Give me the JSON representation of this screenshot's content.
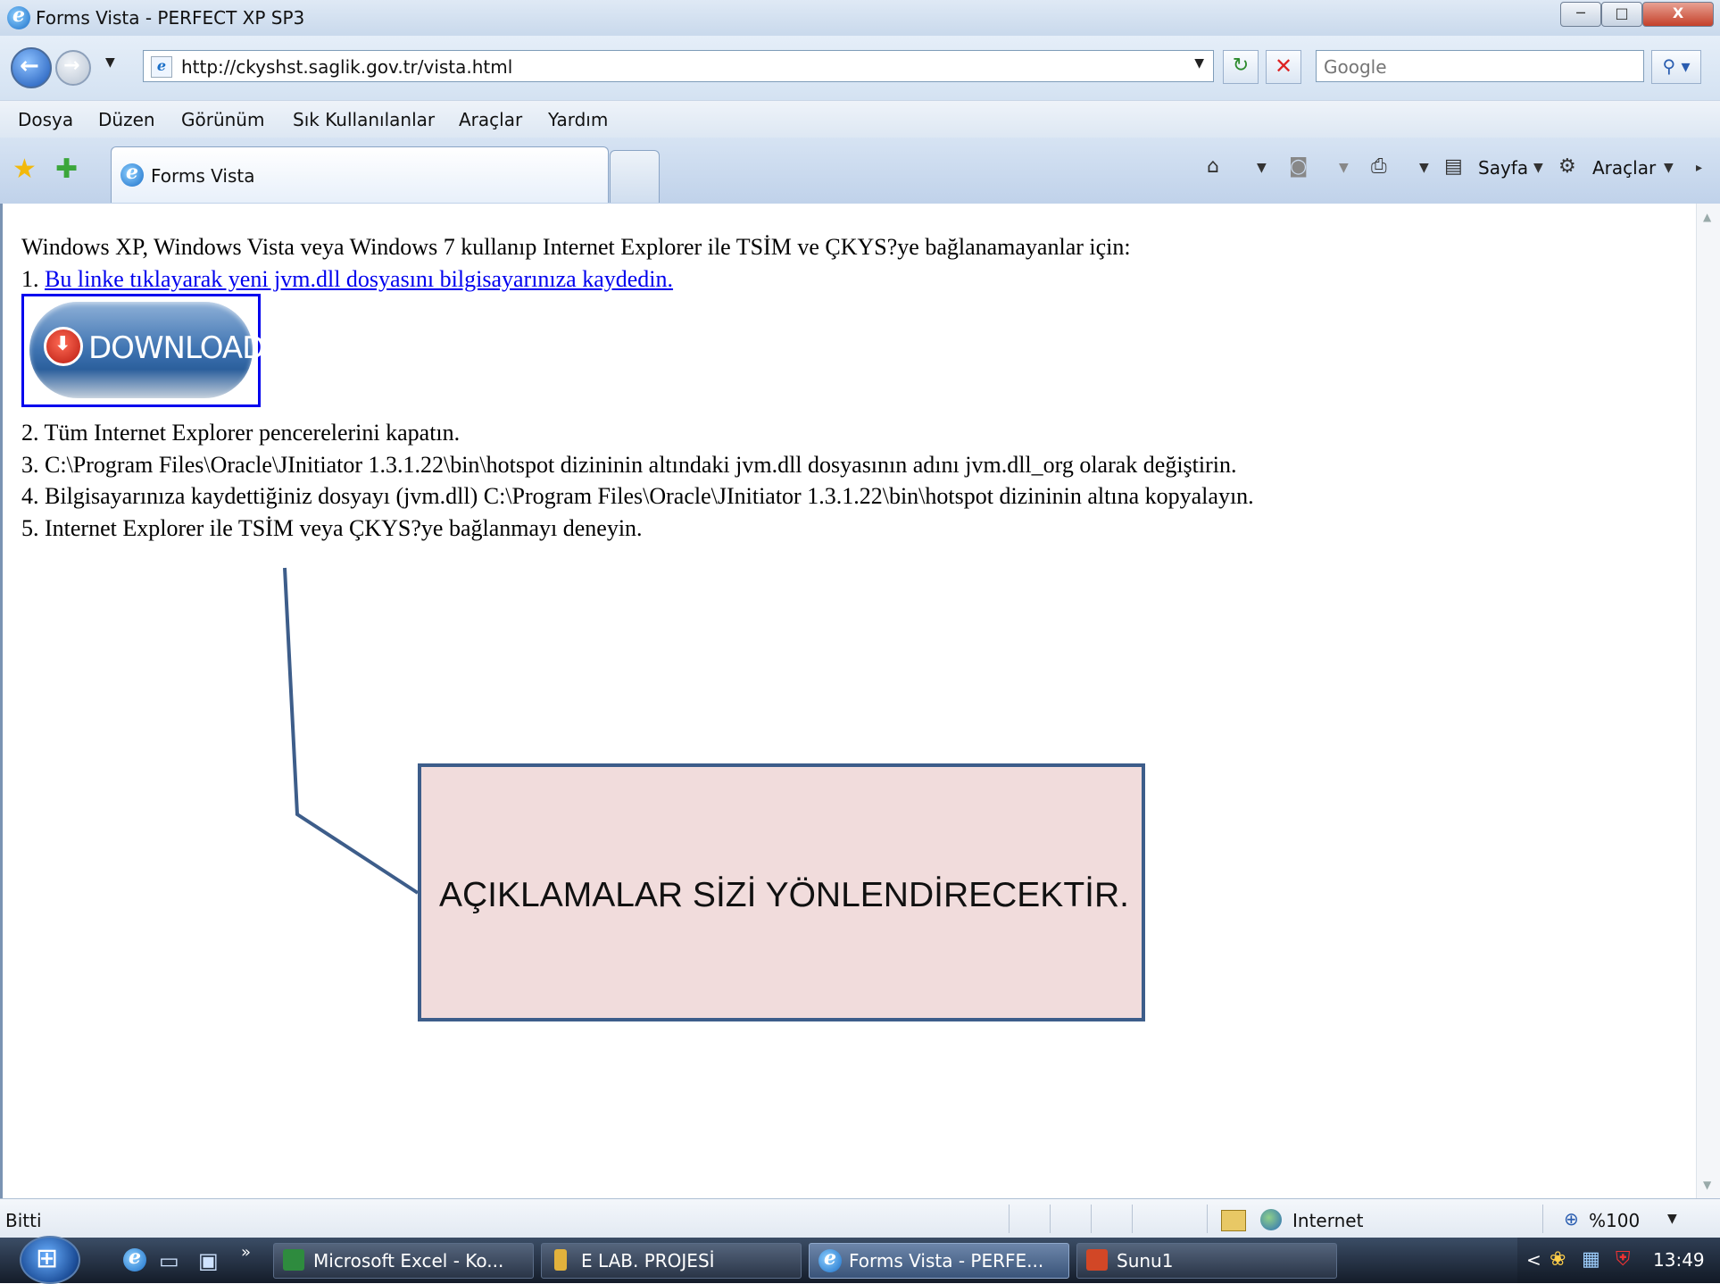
{
  "window": {
    "title": "Forms Vista - PERFECT XP SP3",
    "min_label": "─",
    "max_label": "□",
    "close_label": "X"
  },
  "address_bar": {
    "url": "http://ckyshst.saglik.gov.tr/vista.html",
    "search_placeholder": "Google"
  },
  "menu": [
    "Dosya",
    "Düzen",
    "Görünüm",
    "Sık Kullanılanlar",
    "Araçlar",
    "Yardım"
  ],
  "tabs": [
    {
      "label": "Forms Vista",
      "active": true
    }
  ],
  "command_bar": {
    "page_label": "Sayfa",
    "tools_label": "Araçlar"
  },
  "content": {
    "intro": "Windows XP, Windows Vista veya Windows 7 kullanıp Internet Explorer ile TSİM ve ÇKYS?ye bağlanamayanlar için:",
    "step1_prefix": "1. ",
    "step1_link": "Bu linke tıklayarak yeni jvm.dll dosyasını bilgisayarınıza kaydedin.",
    "download_button": "DOWNLOAD",
    "step2": "2. Tüm Internet Explorer pencerelerini kapatın.",
    "step3": "3. C:\\Program Files\\Oracle\\JInitiator 1.3.1.22\\bin\\hotspot dizininin altındaki jvm.dll dosyasının adını jvm.dll_org olarak değiştirin.",
    "step4": "4. Bilgisayarınıza kaydettiğiniz dosyayı (jvm.dll) C:\\Program Files\\Oracle\\JInitiator 1.3.1.22\\bin\\hotspot dizininin altına kopyalayın.",
    "step5": "5. Internet Explorer ile TSİM veya ÇKYS?ye bağlanmayı deneyin."
  },
  "callout": {
    "text": "AÇIKLAMALAR SİZİ YÖNLENDİRECEKTİR.",
    "fill_color": "#f1dcdc",
    "border_color": "#3d5d8a"
  },
  "status_bar": {
    "status": "Bitti",
    "zone": "Internet",
    "zoom": "%100"
  },
  "taskbar": {
    "buttons": [
      {
        "label": "Microsoft Excel - Ko...",
        "icon": "excel-icon"
      },
      {
        "label": "E LAB. PROJESİ",
        "icon": "folder-icon"
      },
      {
        "label": "Forms Vista - PERFE...",
        "icon": "ie-icon",
        "active": true
      },
      {
        "label": "Sunu1",
        "icon": "powerpoint-icon"
      }
    ],
    "clock": "13:49",
    "overflow": "»"
  }
}
